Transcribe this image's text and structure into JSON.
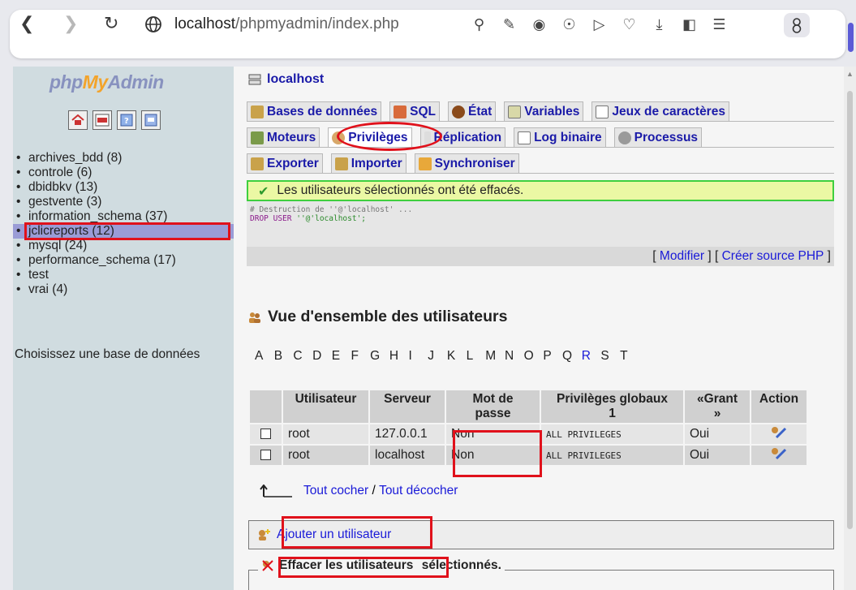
{
  "browser": {
    "url_host": "localhost",
    "url_path": "/phpmyadmin/index.php",
    "toolbar_icons": [
      "find-in-page-icon",
      "edit-icon",
      "screenshot-icon",
      "shield-icon",
      "send-icon",
      "heart-icon",
      "download-icon",
      "sidebar-icon",
      "menu-icon",
      "profile-icon"
    ]
  },
  "sidebar": {
    "logo": {
      "php": "php",
      "my": "My",
      "admin": "Admin"
    },
    "quick_icons": [
      "home-icon",
      "sql-query-icon",
      "docs-icon",
      "sql-window-icon"
    ],
    "databases": [
      {
        "label": "archives_bdd (8)"
      },
      {
        "label": "controle (6)"
      },
      {
        "label": "dbidbkv (13)"
      },
      {
        "label": "gestvente (3)"
      },
      {
        "label": "information_schema (37)"
      },
      {
        "label": "jclicreports (12)"
      },
      {
        "label": "mysql (24)"
      },
      {
        "label": "performance_schema (17)"
      },
      {
        "label": "test"
      },
      {
        "label": "vrai (4)"
      }
    ],
    "choose_label": "Choisissez une base de données"
  },
  "main": {
    "server_label": "localhost",
    "tabs_row1": [
      "Bases de données",
      "SQL",
      "État",
      "Variables",
      "Jeux de caractères"
    ],
    "tabs_row2": [
      "Moteurs",
      "Privilèges",
      "Réplication",
      "Log binaire",
      "Processus"
    ],
    "tabs_row3": [
      "Exporter",
      "Importer",
      "Synchroniser"
    ],
    "success_message": "Les utilisateurs sélectionnés ont été effacés.",
    "sql": {
      "comment": "# Destruction de ''@'localhost' ...",
      "keyword": "DROP USER",
      "string": "''@'localhost';"
    },
    "sql_links": {
      "open": "[ ",
      "modify": "Modifier",
      "mid": " ] [ ",
      "php": "Créer source PHP",
      "close": " ]"
    },
    "overview_title": "Vue d'ensemble des utilisateurs",
    "alphabet": [
      "A",
      "B",
      "C",
      "D",
      "E",
      "F",
      "G",
      "H",
      "I",
      "J",
      "K",
      "L",
      "M",
      "N",
      "O",
      "P",
      "Q",
      "R",
      "S",
      "T"
    ],
    "alphabet_active": "R",
    "table": {
      "headers": [
        "Utilisateur",
        "Serveur",
        "Mot de passe",
        "Privilèges globaux 1",
        "«Grant »",
        "Action"
      ],
      "header_lines": {
        "password_1": "Mot de",
        "password_2": "passe",
        "priv_1": "Privilèges globaux",
        "priv_2": "1",
        "grant_1": "«Grant",
        "grant_2": "»"
      },
      "rows": [
        {
          "user": "root",
          "host": "127.0.0.1",
          "password": "Non",
          "privileges": "ALL PRIVILEGES",
          "grant": "Oui"
        },
        {
          "user": "root",
          "host": "localhost",
          "password": "Non",
          "privileges": "ALL PRIVILEGES",
          "grant": "Oui"
        }
      ]
    },
    "check_all": "Tout cocher",
    "separator": " / ",
    "uncheck_all": "Tout décocher",
    "add_user": "Ajouter un utilisateur",
    "delete_selected": "Effacer les utilisateurs",
    "delete_suffix": " sélectionnés."
  }
}
